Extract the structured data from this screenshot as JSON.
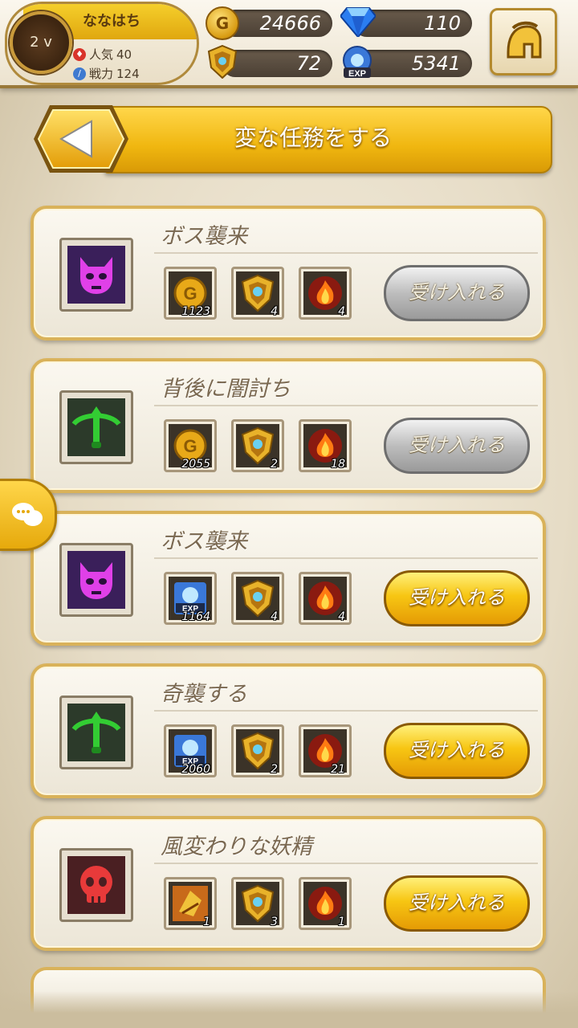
{
  "player": {
    "name": "ななはち",
    "level": "2 v",
    "popularity_label": "人気",
    "popularity": "40",
    "power_label": "戦力",
    "power": "124"
  },
  "resources": {
    "gold": "24666",
    "gems": "110",
    "shields": "72",
    "exp": "5341",
    "gold_icon_letter": "G",
    "exp_icon_label": "EXP"
  },
  "screen": {
    "title": "変な任務をする"
  },
  "missions": [
    {
      "title": "ボス襲来",
      "icon": "purple-demon-skull",
      "rewards": [
        {
          "type": "gold",
          "qty": "1123"
        },
        {
          "type": "shield",
          "qty": "4"
        },
        {
          "type": "fire",
          "qty": "4"
        }
      ],
      "button": "受け入れる",
      "button_state": "disabled"
    },
    {
      "title": "背後に闇討ち",
      "icon": "green-crossbow",
      "rewards": [
        {
          "type": "gold",
          "qty": "2055"
        },
        {
          "type": "shield",
          "qty": "2"
        },
        {
          "type": "fire",
          "qty": "18"
        }
      ],
      "button": "受け入れる",
      "button_state": "disabled"
    },
    {
      "title": "ボス襲来",
      "icon": "purple-demon-skull",
      "rewards": [
        {
          "type": "exp",
          "qty": "1164"
        },
        {
          "type": "shield",
          "qty": "4"
        },
        {
          "type": "fire",
          "qty": "4"
        }
      ],
      "button": "受け入れる",
      "button_state": "active"
    },
    {
      "title": "奇襲する",
      "icon": "green-crossbow",
      "rewards": [
        {
          "type": "exp",
          "qty": "2060"
        },
        {
          "type": "shield",
          "qty": "2"
        },
        {
          "type": "fire",
          "qty": "21"
        }
      ],
      "button": "受け入れる",
      "button_state": "active"
    },
    {
      "title": "風変わりな妖精",
      "icon": "red-skull",
      "rewards": [
        {
          "type": "scroll",
          "qty": "1"
        },
        {
          "type": "shield",
          "qty": "3"
        },
        {
          "type": "fire",
          "qty": "1"
        }
      ],
      "button": "受け入れる",
      "button_state": "active"
    }
  ],
  "colors": {
    "accent_gold": "#f0b710",
    "card_border": "#d9b25a",
    "gray_button": "#a8a8a8",
    "purple_icon": "#e040e8",
    "green_icon": "#33cc33",
    "red_icon": "#e83a3a"
  }
}
